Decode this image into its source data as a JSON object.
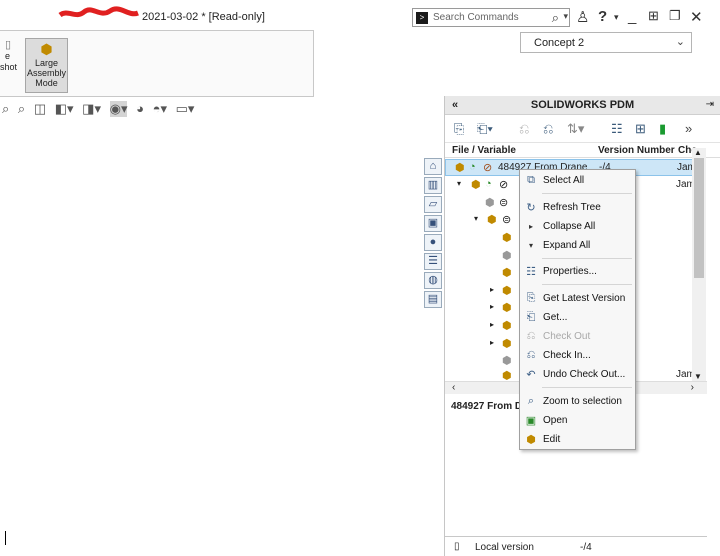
{
  "titlebar": {
    "doc_title": "2021-03-02 * [Read-only]",
    "search_placeholder": "Search Commands",
    "icons": [
      "search-icon",
      "user-icon",
      "help-icon",
      "minimize-icon",
      "restore-icon",
      "maximize-icon",
      "close-icon"
    ]
  },
  "ribbon": {
    "partial_label_line1": "e",
    "partial_label_line2": "shot",
    "large_assembly_mode_line1": "Large",
    "large_assembly_mode_line2": "Assembly",
    "large_assembly_mode_line3": "Mode"
  },
  "config": {
    "selected": "Concept 2"
  },
  "pdm": {
    "title": "SOLIDWORKS PDM",
    "collapse_label": "«",
    "more_label": "»",
    "columns": {
      "file": "File / Variable",
      "version": "Version Number",
      "checked": "Che"
    },
    "selected_row": {
      "name": "484927 From Drane",
      "version": "-/4",
      "checked": "Jam"
    },
    "row2_checked": "Jam",
    "bottom_row_checked": "Jam",
    "detail_label": "484927 From D",
    "local_version_label": "Local version",
    "local_version_value": "-/4"
  },
  "context_menu": {
    "items": [
      {
        "label": "Select All",
        "icon": "select-all-icon",
        "enabled": true
      },
      {
        "label": "Refresh Tree",
        "icon": "refresh-icon",
        "enabled": true
      },
      {
        "label": "Collapse All",
        "icon": "collapse-arrow-icon",
        "enabled": true
      },
      {
        "label": "Expand All",
        "icon": "expand-arrow-icon",
        "enabled": true
      },
      {
        "label": "Properties...",
        "icon": "properties-icon",
        "enabled": true
      },
      {
        "label": "Get Latest Version",
        "icon": "get-latest-icon",
        "enabled": true
      },
      {
        "label": "Get...",
        "icon": "get-icon",
        "enabled": true
      },
      {
        "label": "Check Out",
        "icon": "check-out-icon",
        "enabled": false
      },
      {
        "label": "Check In...",
        "icon": "check-in-icon",
        "enabled": true
      },
      {
        "label": "Undo Check Out...",
        "icon": "undo-check-out-icon",
        "enabled": true
      },
      {
        "label": "Zoom to selection",
        "icon": "zoom-icon",
        "enabled": true
      },
      {
        "label": "Open",
        "icon": "open-icon",
        "enabled": true
      },
      {
        "label": "Edit",
        "icon": "edit-icon",
        "enabled": true
      }
    ]
  }
}
